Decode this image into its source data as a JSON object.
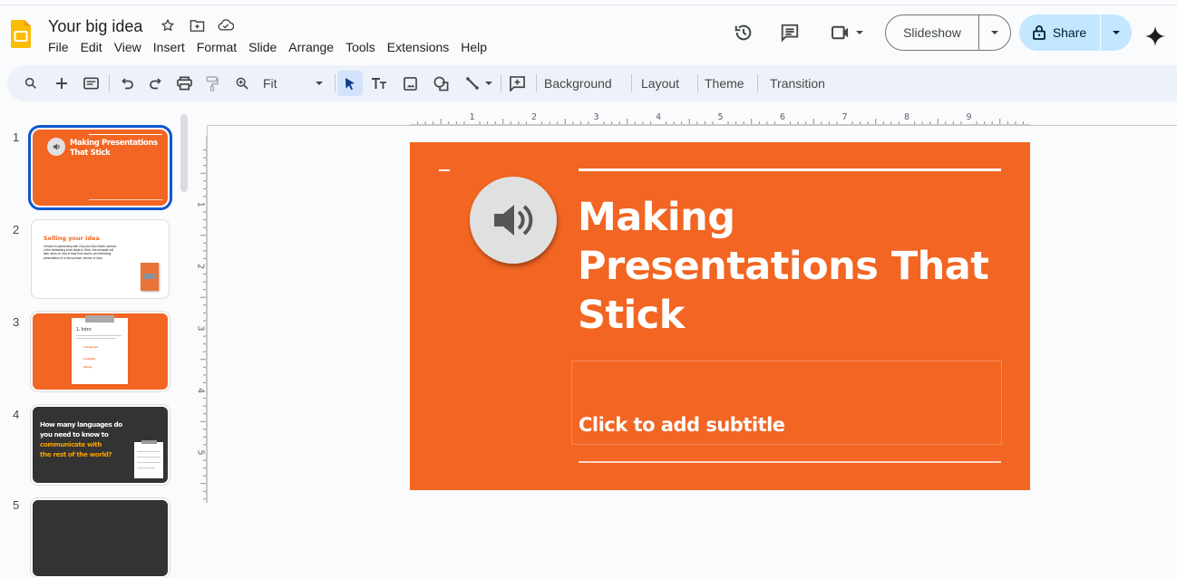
{
  "header": {
    "doc_title": "Your big idea",
    "menu": [
      "File",
      "Edit",
      "View",
      "Insert",
      "Format",
      "Slide",
      "Arrange",
      "Tools",
      "Extensions",
      "Help"
    ],
    "slideshow_label": "Slideshow",
    "share_label": "Share"
  },
  "toolbar": {
    "zoom_value": "Fit",
    "background_label": "Background",
    "layout_label": "Layout",
    "theme_label": "Theme",
    "transition_label": "Transition"
  },
  "rulers": {
    "horizontal": [
      "1",
      "2",
      "3",
      "4",
      "5",
      "6",
      "7",
      "8",
      "9"
    ],
    "vertical": [
      "1",
      "2",
      "3",
      "4",
      "5"
    ]
  },
  "slides": [
    {
      "number": "1",
      "title": "Making Presentations That Stick",
      "bg": "#f26522"
    },
    {
      "number": "2",
      "title": "Selling your idea",
      "body": "Created in partnership with Chip and Dan Heath, authors of the bestselling book Made to Stick, this template will take users on how to lead from start to an interesting presentation of a new product, service or idea.",
      "bg": "#ffffff"
    },
    {
      "number": "3",
      "title": "1. Intro",
      "items": [
        "Unexpected",
        "Credibility",
        "Simple"
      ],
      "bg": "#f26522"
    },
    {
      "number": "4",
      "title_line1": "How many languages do",
      "title_line2": "you need to know to",
      "title_line3": "communicate with",
      "title_line4": "the rest of the world?",
      "bg": "#333333"
    },
    {
      "number": "5"
    }
  ],
  "current_slide": {
    "title_lines": [
      "Making",
      "Presentations That",
      "Stick"
    ],
    "subtitle_placeholder": "Click to add subtitle"
  },
  "colors": {
    "accent_orange": "#f26522",
    "share_bg": "#c2e7ff",
    "selection_blue": "#0b57d0",
    "slide4_highlight": "#f5a000"
  }
}
